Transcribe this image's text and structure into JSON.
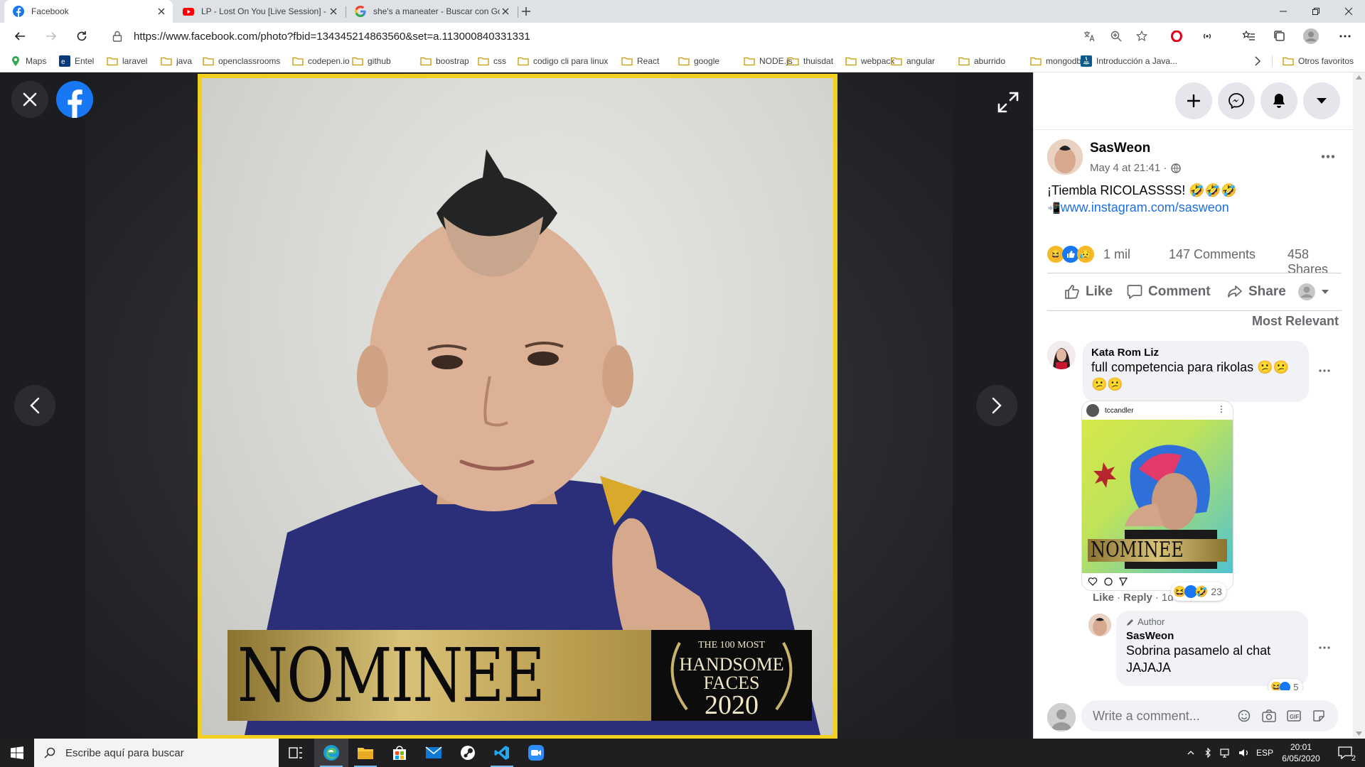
{
  "browser": {
    "tabs": [
      {
        "title": "Facebook",
        "icon": "facebook-icon",
        "active": true
      },
      {
        "title": "LP - Lost On You [Live Session] -",
        "icon": "youtube-icon",
        "active": false
      },
      {
        "title": "she's a maneater - Buscar con Go",
        "icon": "google-icon",
        "active": false
      }
    ],
    "url": "https://www.facebook.com/photo?fbid=134345214863560&set=a.113000840331331",
    "bookmarks": [
      "Maps",
      "Entel",
      "laravel",
      "java",
      "openclassrooms",
      "codepen.io",
      "github",
      "boostrap",
      "css",
      "codigo cli para linux",
      "React",
      "google",
      "NODE.js",
      "thuisdat",
      "webpack",
      "angular",
      "aburrido",
      "mongodb",
      "Introducción a Java..."
    ],
    "other_bookmarks": "Otros favoritos"
  },
  "photo": {
    "banner_word": "NOMINEE",
    "badge_line1": "THE 100 MOST",
    "badge_line2": "HANDSOME",
    "badge_line3": "FACES",
    "badge_year": "2020"
  },
  "post": {
    "author": "SasWeon",
    "date": "May 4 at 21:41 ·",
    "text": "¡Tiembla RICOLASSSS! 🤣🤣🤣",
    "link": "www.instagram.com/sasweon",
    "reactions_count": "1 mil",
    "comments": "147 Comments",
    "shares": "458 Shares",
    "actions": {
      "like": "Like",
      "comment": "Comment",
      "share": "Share"
    },
    "sort": "Most Relevant"
  },
  "comments": [
    {
      "author": "Kata Rom Liz",
      "text": "full competencia para rikolas 😕😕😕😕",
      "image_user": "tccandler",
      "image_word": "NOMINEE",
      "like": "Like",
      "reply": "Reply",
      "time": "1d",
      "reaction_count": "23"
    },
    {
      "badge": "Author",
      "author": "SasWeon",
      "text": "Sobrina pasamelo al chat JAJAJA",
      "reaction_count": "5"
    }
  ],
  "composer": {
    "placeholder": "Write a comment..."
  },
  "taskbar": {
    "search_placeholder": "Escribe aquí para buscar",
    "lang": "ESP",
    "time": "20:01",
    "date": "6/05/2020",
    "notifications": "2"
  },
  "colors": {
    "facebook_blue": "#1877f2",
    "frame_yellow": "#f3cf20",
    "link_blue": "#216fdb"
  }
}
